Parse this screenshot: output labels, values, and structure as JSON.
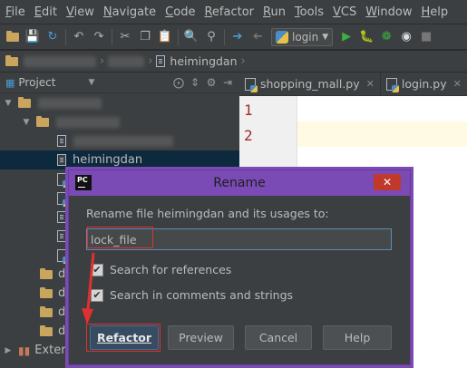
{
  "menu": [
    {
      "u": "F",
      "rest": "ile"
    },
    {
      "u": "E",
      "rest": "dit"
    },
    {
      "u": "V",
      "rest": "iew"
    },
    {
      "u": "N",
      "rest": "avigate"
    },
    {
      "u": "C",
      "rest": "ode"
    },
    {
      "u": "R",
      "rest": "efactor"
    },
    {
      "u": "R",
      "rest": "un"
    },
    {
      "u": "T",
      "rest": "ools"
    },
    {
      "u": "V",
      "rest": "CS"
    },
    {
      "u": "W",
      "rest": "indow"
    },
    {
      "u": "H",
      "rest": "elp"
    }
  ],
  "toolbar": {
    "run_config": "login"
  },
  "breadcrumb": {
    "file": "heimingdan"
  },
  "project": {
    "title": "Project",
    "selected_file": "heimingdan",
    "folder_prefix": "da",
    "external": "Extern"
  },
  "tabs": [
    {
      "label": "shopping_mall.py"
    },
    {
      "label": "login.py"
    }
  ],
  "editor": {
    "line_numbers": [
      "1",
      "2"
    ]
  },
  "dialog": {
    "title": "Rename",
    "prompt": "Rename file heimingdan and its usages to:",
    "input_value": "lock_file",
    "search_references": "Search for references",
    "search_comments": "Search in comments and strings",
    "search_references_checked": true,
    "search_comments_checked": true,
    "buttons": {
      "refactor": "Refactor",
      "preview": "Preview",
      "cancel": "Cancel",
      "help": "Help"
    }
  },
  "colors": {
    "dialog_border": "#7b4bb5",
    "annotation_red": "#e03030",
    "selection": "#0d293e"
  }
}
